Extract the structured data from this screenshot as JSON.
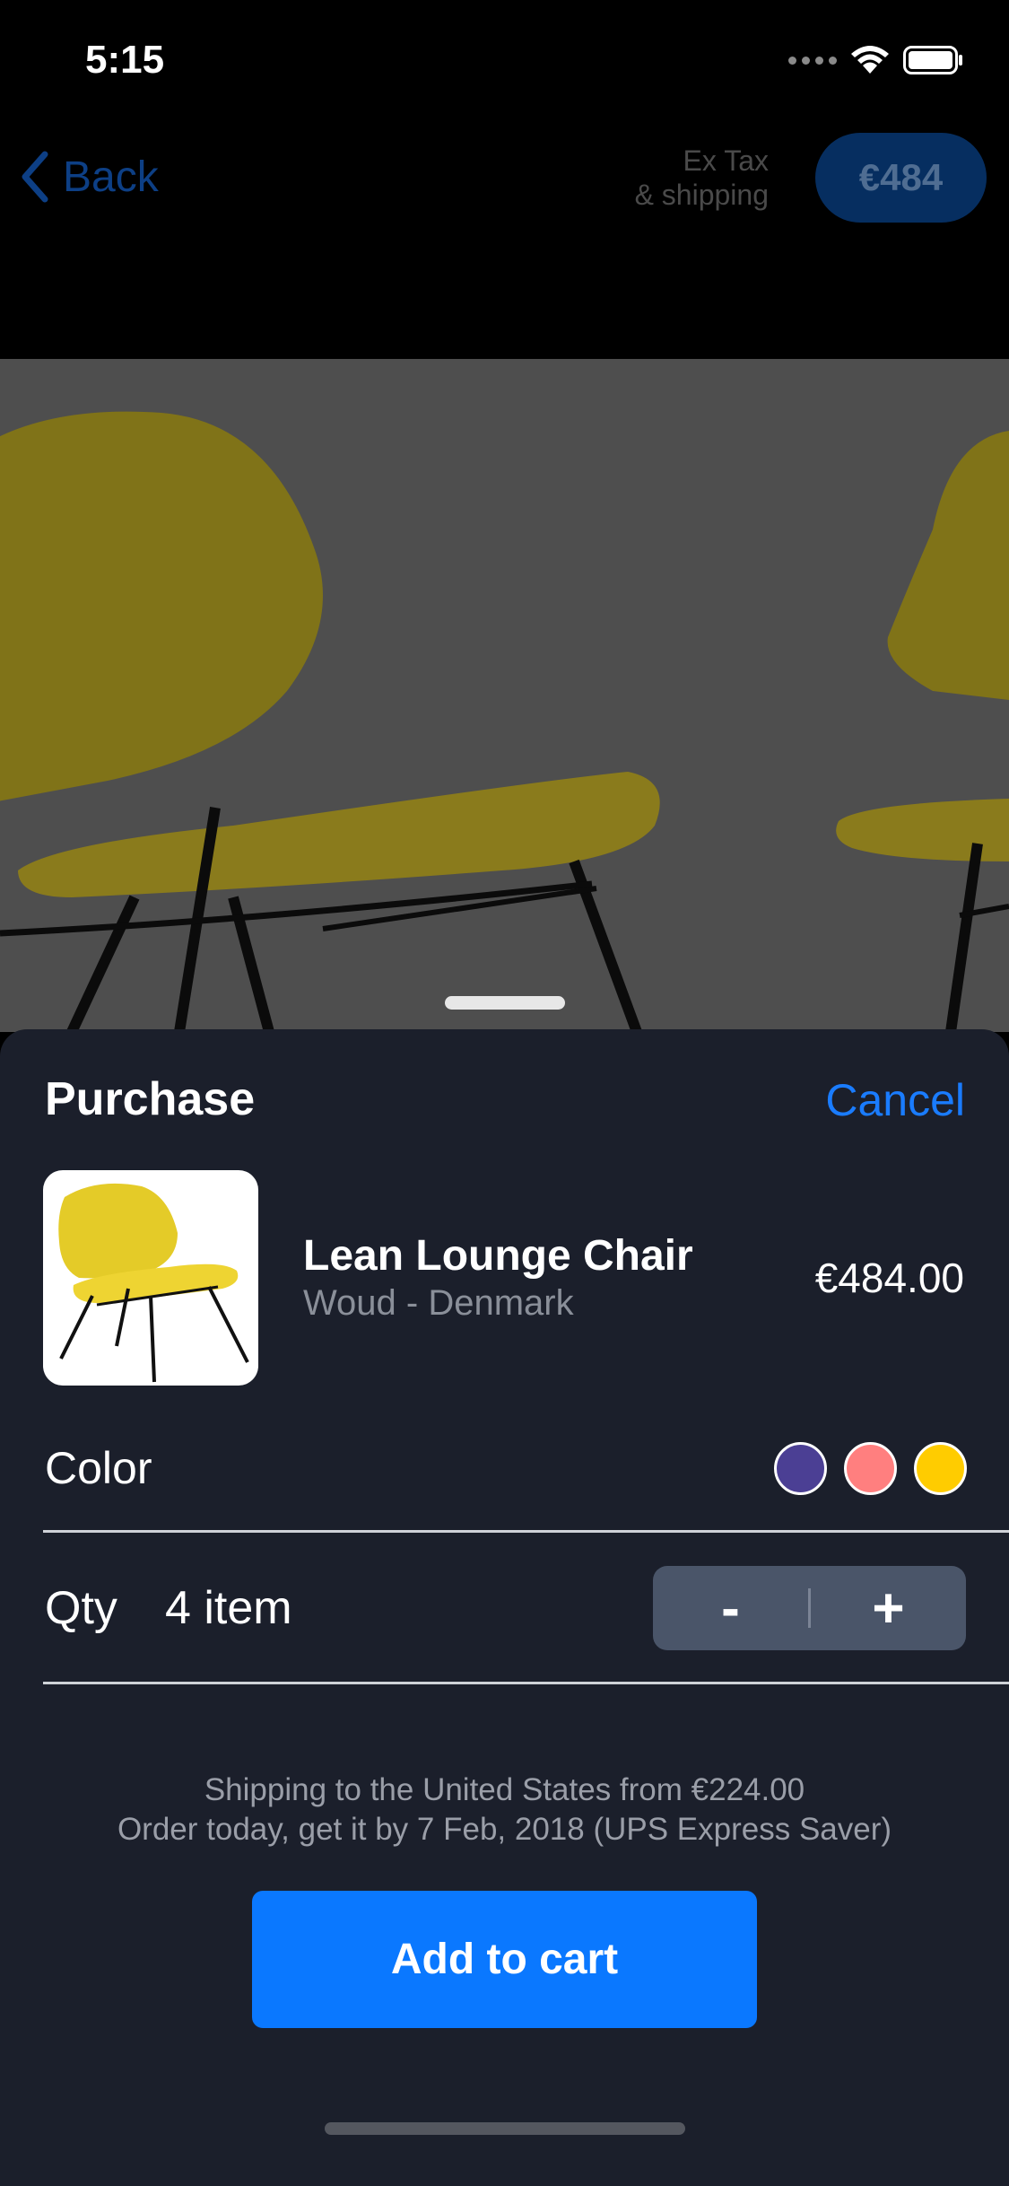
{
  "status_bar": {
    "time": "5:15",
    "icons": [
      "cellular-dots-icon",
      "wifi-icon",
      "battery-icon"
    ]
  },
  "nav": {
    "back_label": "Back",
    "price_note_line1": "Ex Tax",
    "price_note_line2": "& shipping",
    "price_pill": "€484"
  },
  "sheet": {
    "title": "Purchase",
    "cancel_label": "Cancel",
    "product": {
      "name": "Lean Lounge Chair",
      "brand": "Woud - Denmark",
      "price": "€484.00"
    },
    "color": {
      "label": "Color",
      "swatches": [
        "#4b3f94",
        "#ff7f7f",
        "#ffcc00"
      ]
    },
    "qty": {
      "label": "Qty",
      "value": "4 item",
      "minus": "-",
      "plus": "+"
    },
    "shipping_line1": "Shipping to the United States from €224.00",
    "shipping_line2": "Order today, get it by 7 Feb, 2018 (UPS Express Saver)",
    "cart_button": "Add to cart"
  },
  "colors": {
    "accent": "#0a78ff",
    "sheet_bg": "#1b1f2b",
    "chair": "#c6b12a"
  }
}
